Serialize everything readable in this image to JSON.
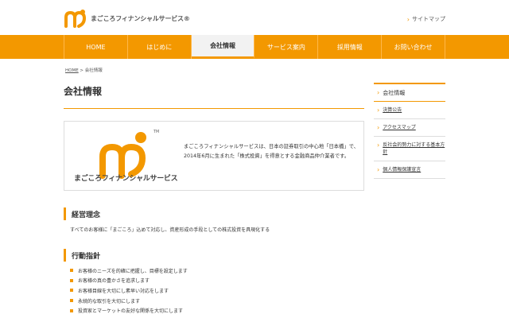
{
  "header": {
    "logo_text": "まごころフィナンシャルサービス®",
    "sitemap_label": "サイトマップ"
  },
  "nav": {
    "items": [
      {
        "label": "HOME"
      },
      {
        "label": "はじめに"
      },
      {
        "label": "会社情報"
      },
      {
        "label": "サービス案内"
      },
      {
        "label": "採用情報"
      },
      {
        "label": "お問い合わせ"
      }
    ],
    "active": "会社情報"
  },
  "breadcrumb": {
    "home": "HOME",
    "separator": " > ",
    "current": "会社情報"
  },
  "main": {
    "title": "会社情報",
    "company": {
      "logo_text": "まごころフィナンシャルサービス",
      "tm": "TM",
      "description": "まごころフィナンシャルサービスは、日本の証券取引の中心地「日本橋」で、2014年6月に生まれた「株式投資」を得意とする金融商品仲介業者です。"
    },
    "philosophy": {
      "heading": "経営理念",
      "text": "すべてのお客様に「まごころ」込めて対応し、資産形成の手段としての株式投資を具現化する"
    },
    "actions": {
      "heading": "行動指針",
      "items": [
        "お客様のニーズを的確に把握し、目標を設定します",
        "お客様の真の豊かさを追求します",
        "お客様目線を大切にし素早い対応をします",
        "永続的な取引を大切にします",
        "投資家とマーケットの友好な関係を大切にします"
      ]
    }
  },
  "sidebar": {
    "heading": "会社情報",
    "items": [
      {
        "label": "決算公告"
      },
      {
        "label": "アクセスマップ"
      },
      {
        "label": "反社会的勢力に対する基本方針"
      },
      {
        "label": "個人情報保護宣言"
      }
    ]
  },
  "colors": {
    "brand_orange": "#f39800",
    "nav_active_bg": "#f2f2f2"
  }
}
